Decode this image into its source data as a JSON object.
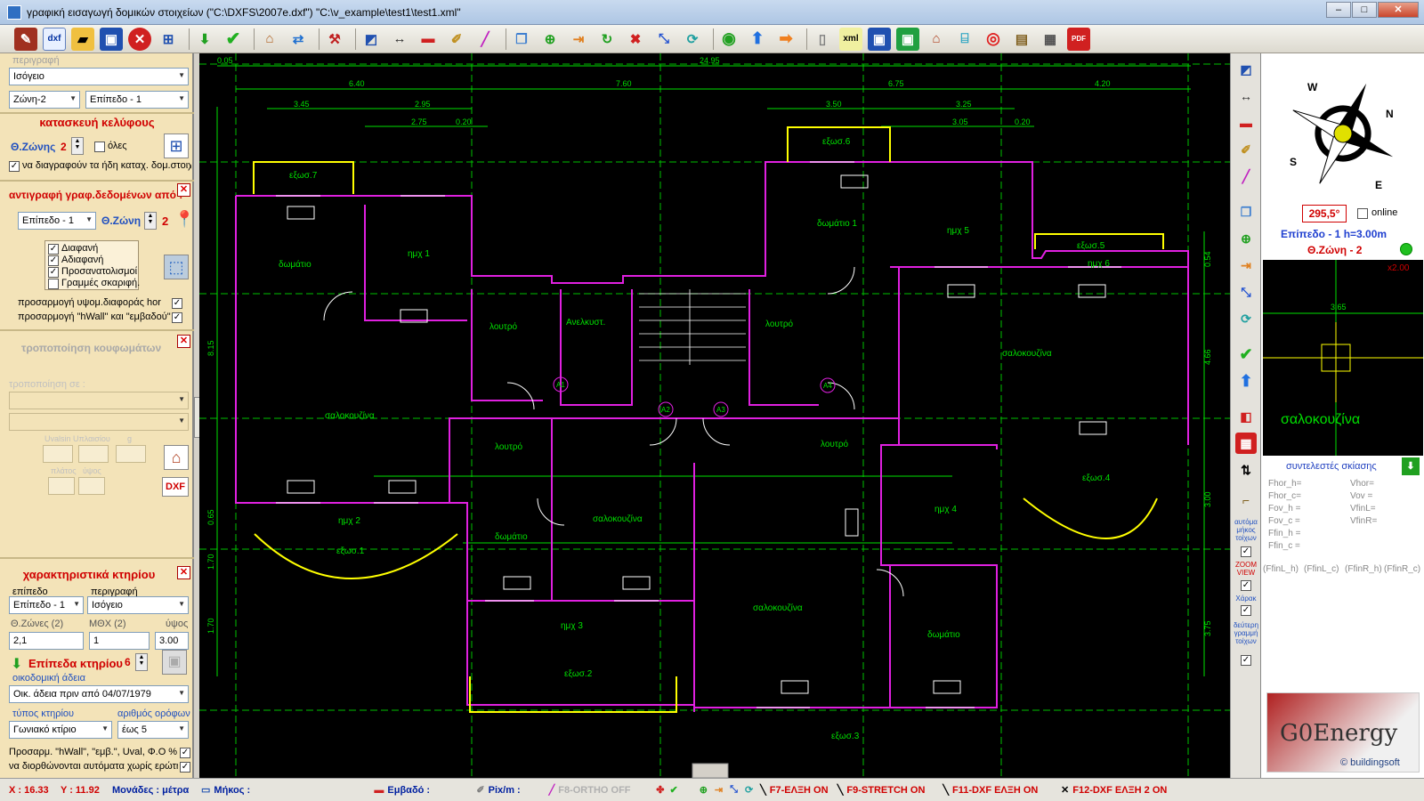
{
  "window": {
    "title": "γραφική εισαγωγή δομικών στοιχείων (\"C:\\DXFS\\2007e.dxf\") \"C:\\v_example\\test1\\test1.xml\"",
    "min": "–",
    "max": "□",
    "close": "✕"
  },
  "toolbar": {
    "icons": [
      "edit-icon",
      "dxf-icon",
      "open-folder-icon",
      "save-icon",
      "delete-icon",
      "grid-icon",
      "download-icon",
      "check-icon",
      "house-icon",
      "swap-icon",
      "tools-icon",
      "measure-icon",
      "dimension-icon",
      "fill-icon",
      "pencil-icon",
      "line-icon",
      "page-icon",
      "add-icon",
      "export-icon",
      "refresh-icon",
      "cross-icon",
      "stretch-icon",
      "rotate-icon",
      "go-icon",
      "up-icon",
      "right-icon",
      "new-icon",
      "xml-icon",
      "save2-icon",
      "save3-icon",
      "building-icon",
      "cylinder-icon",
      "target-icon",
      "clipboard-icon",
      "calculator-icon",
      "pdf-icon"
    ],
    "dxf_label": "dxf",
    "xml_label": "xml",
    "pdf_label": "PDF"
  },
  "left": {
    "perigrafi_label": "περιγραφή",
    "perigrafi_value": "Ισόγειο",
    "zone_value": "Ζώνη-2",
    "level_value": "Επίπεδο - 1",
    "shell_title": "κατασκευή κελύφους",
    "thzone_label": "Θ.Ζώνης",
    "thzone_value": "2",
    "all_label": "όλες",
    "delete_label": "να διαγραφούν τα ήδη καταχ. δομ.στοιχ",
    "copy_title": "αντιγραφή γραφ.δεδομένων από :",
    "copy_level": "Επίπεδο - 1",
    "copy_zone_label": "Θ.Ζώνη",
    "copy_zone_value": "2",
    "layers": [
      "Διαφανή",
      "Αδιαφανή",
      "Προσανατολισμοί",
      "Γραμμές σκαριφή."
    ],
    "adj_hor": "προσαρμογή υψομ.διαφοράς hor",
    "adj_hwall": "προσαρμογή \"hWall\" και \"εμβαδού\"",
    "mod_title": "τροποποίηση κουφωμάτων",
    "mod_to": "τροποποίηση σε :",
    "uval_label": "Uvalsin Uπλαισίου",
    "g_label": "g",
    "width_label": "πλάτος",
    "height_label": "ύψος",
    "dxf_btn": "DXF",
    "bld_title": "χαρακτηριστικά κτηρίου",
    "level_col": "επίπεδο",
    "desc_col": "περιγραφή",
    "bld_level": "Επίπεδο - 1",
    "bld_desc": "Ισόγειο",
    "zones_label": "Θ.Ζώνες (2)",
    "mthx_label": "ΜΘΧ (2)",
    "ypsos_label": "ύψος",
    "zones_value": "2,1",
    "mthx_value": "1",
    "ypsos_value": "3.00",
    "levels_label": "Επίπεδα κτηρίου",
    "levels_value": "6",
    "permit_label": "οικοδομική άδεια",
    "permit_value": "Οικ. άδεια πριν από 04/07/1979",
    "type_label": "τύπος κτηρίου",
    "floors_label": "αριθμός ορόφων",
    "type_value": "Γωνιακό κτίριο",
    "floors_value": "έως 5",
    "adapt_label": "Προσαρμ. \"hWall\", \"εμβ.\", Uval, Φ.Ο %",
    "fix_label": "να διορθώνονται αυτόματα χωρίς ερώτη"
  },
  "plan": {
    "dims_top": [
      "0.05",
      "24.95",
      "6.40",
      "7.60",
      "6.75",
      "4.20",
      "3.45",
      "2.95",
      "3.50",
      "3.25",
      "2.75",
      "0.20",
      "3.05",
      "0.20"
    ],
    "dims_left": [
      "8.15",
      "0.65",
      "1.70",
      "1.70"
    ],
    "dims_right": [
      "0.54",
      "4.66",
      "3.00",
      "3.75"
    ],
    "rooms": [
      "εξωσ.7",
      "δωμάτιο",
      "ημχ 1",
      "λουτρό",
      "Ανελκυστ.",
      "λουτρό",
      "δωμάτιο 1",
      "ημχ 5",
      "εξωσ.6",
      "εξωσ.5",
      "ημχ 6",
      "σαλοκουζίνα",
      "σαλοκουζίνα",
      "λουτρό",
      "λουτρό",
      "εξωσ.4",
      "ημχ 4",
      "ημχ 2",
      "εξωσ.1",
      "δωμάτιο",
      "σαλοκουζίνα",
      "σαλοκουζίνα",
      "ημχ 3",
      "δωμάτιο",
      "εξωσ.2",
      "εξωσ.3"
    ],
    "marks": [
      "A1",
      "A2",
      "A3",
      "A4"
    ]
  },
  "vtools": [
    "measure-icon",
    "dimension-icon",
    "fill-icon",
    "pencil-icon",
    "line-icon",
    "page-icon",
    "add-icon",
    "export-icon",
    "stretch-icon",
    "rotate-icon",
    "check-icon",
    "up-icon",
    "door-icon",
    "grid-icon",
    "arrows-icon",
    "stairs-icon"
  ],
  "vtool_labels": {
    "auto_length": "αυτόμα μήκος τοίχων",
    "zoom_view": "ZOOM VIEW",
    "xarak": "Χάρακ",
    "second_lines": "δεύτερη γραμμή τοίχων"
  },
  "right": {
    "compass_letters": [
      "W",
      "N",
      "S",
      "E"
    ],
    "angle": "295,5°",
    "online": "online",
    "level_info": "Επίπεδο - 1  h=3.00m",
    "zone_info": "Θ.Ζώνη - 2",
    "zoom_label": "x2.00",
    "preview_dim": "3.65",
    "preview_room": "σαλοκουζίνα",
    "shading_title": "συντελεστές σκίασης",
    "coefs_left": [
      "Fhor_h=",
      "Fhor_c=",
      "Fov_h =",
      "Fov_c =",
      "Ffin_h =",
      "Ffin_c ="
    ],
    "coefs_right": [
      "Vhor=",
      "Vov =",
      "VfinL=",
      "VfinR="
    ],
    "coefs_bottom": [
      "(FfinL_h)",
      "(FfinL_c)",
      "(FfinR_h)",
      "(FfinR_c)"
    ],
    "brand": "G0Energy",
    "brand_sub": "© buildingsoft"
  },
  "status": {
    "x": "X : 16.33",
    "y": "Y : 11.92",
    "units": "Μονάδες : μέτρα",
    "length": "Μήκος :",
    "area": "Εμβαδό :",
    "pix": "Pix/m :",
    "f8": "F8-ORTHO OFF",
    "f7": "F7-ΕΛΞΗ ON",
    "f9": "F9-STRETCH ON",
    "f11": "F11-DXF ΕΛΞΗ ON",
    "f12": "F12-DXF ΕΛΞΗ 2 ON"
  }
}
